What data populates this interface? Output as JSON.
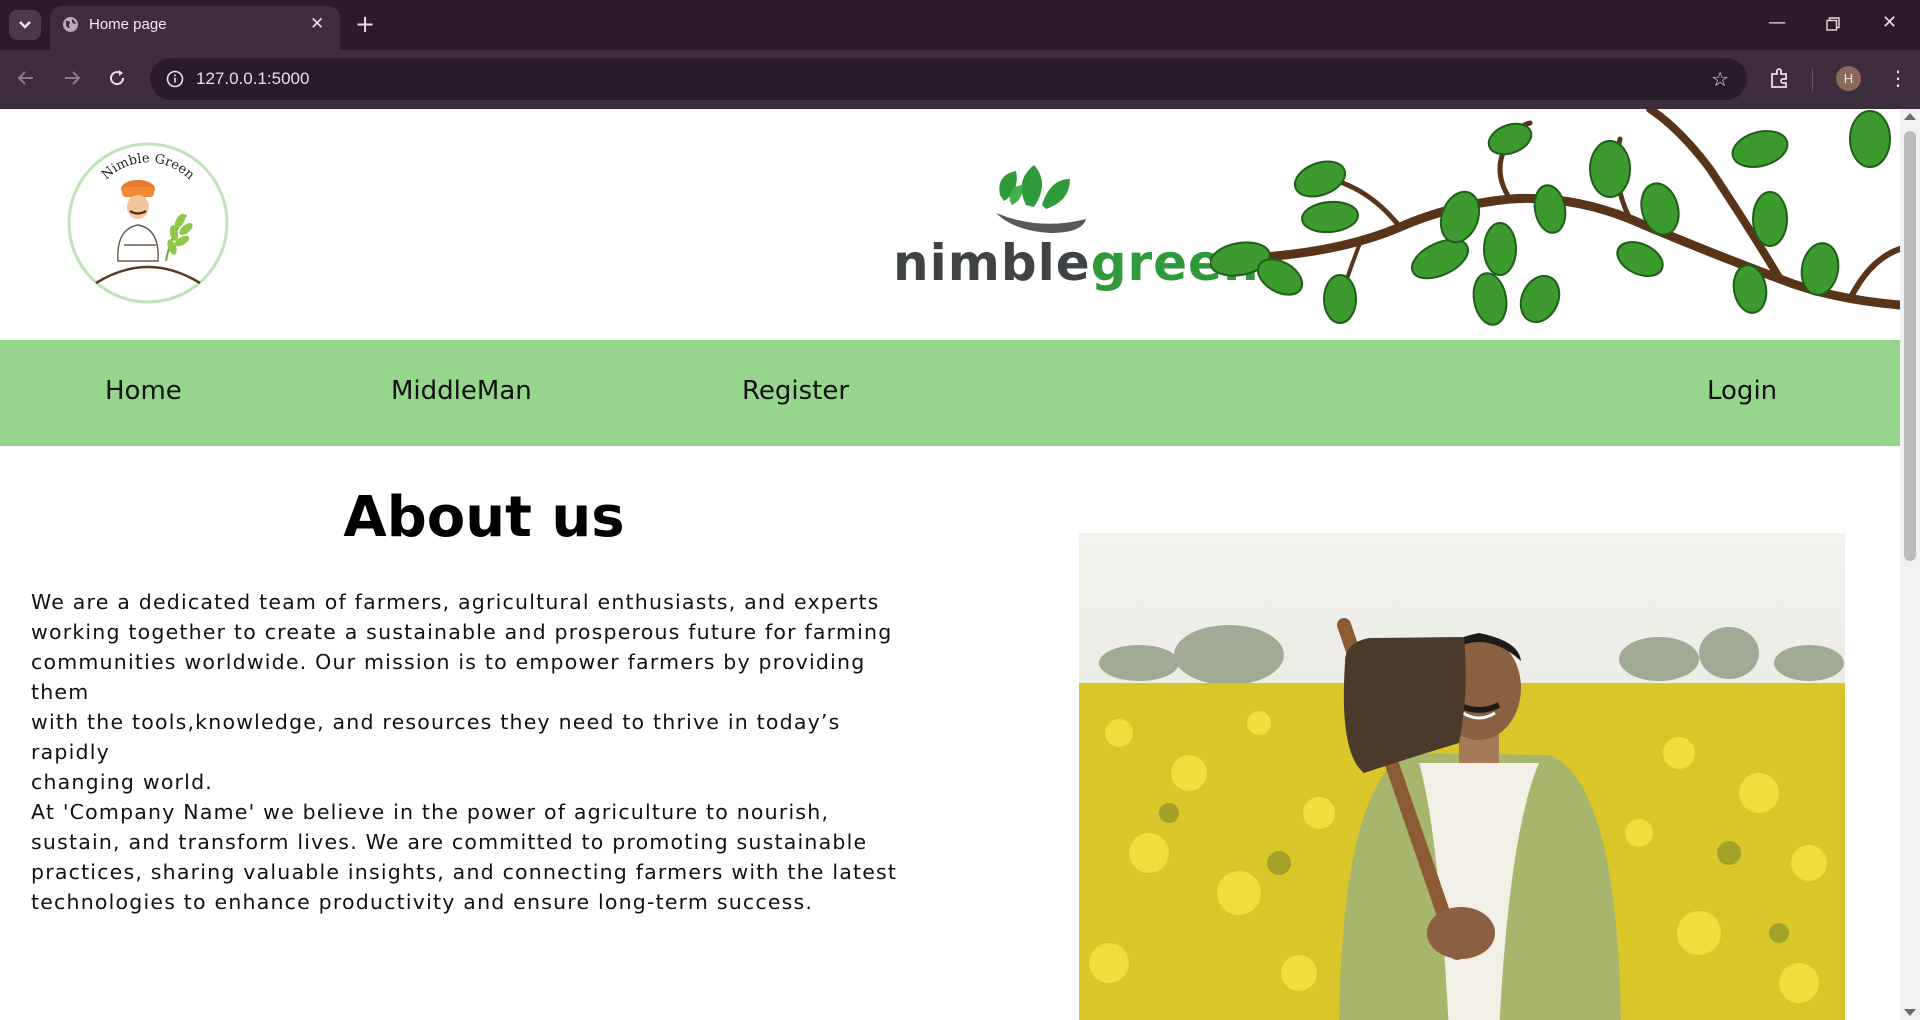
{
  "browser": {
    "tab_title": "Home page",
    "url": "127.0.0.1:5000",
    "profile_initial": "H"
  },
  "header": {
    "logo_arc_text": "Nimble Green",
    "brand_part1": "nimble",
    "brand_part2": "green"
  },
  "nav": {
    "home": "Home",
    "middleman": "MiddleMan",
    "register": "Register",
    "login": "Login"
  },
  "about": {
    "title": "About us",
    "lines": [
      "We are a dedicated team of farmers, agricultural enthusiasts, and experts",
      "working together to create a sustainable and prosperous future for farming",
      "communities worldwide. Our mission is to empower farmers by providing",
      "them",
      "with the tools,knowledge, and resources they need to thrive in today’s",
      "rapidly",
      "changing world.",
      "At 'Company Name' we believe in the power of agriculture to nourish,",
      "sustain, and transform lives. We are committed to promoting sustainable",
      "practices, sharing valuable insights, and connecting farmers with the latest",
      "technologies to enhance productivity and ensure long-term success."
    ]
  },
  "colors": {
    "nav_bg": "#96d68c",
    "brand_green": "#2e9a3a",
    "brand_gray": "#3f4346",
    "chrome_bg": "#2b1b29"
  }
}
